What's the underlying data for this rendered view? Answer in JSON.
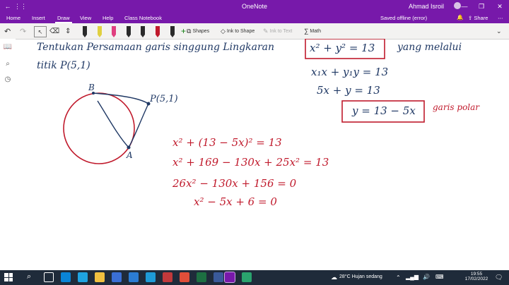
{
  "app": {
    "title": "OneNote",
    "user": "Ahmad Isroil"
  },
  "tabs": [
    "Home",
    "Insert",
    "Draw",
    "View",
    "Help",
    "Class Notebook"
  ],
  "active_tab": "Draw",
  "status": {
    "saved": "Saved offline (error)",
    "share": "Share"
  },
  "ribbon": {
    "shapes": "Shapes",
    "ink_to_shape": "Ink to Shape",
    "ink_to_text": "Ink to Text",
    "math": "Math"
  },
  "pens": [
    "#2b2b2b",
    "#e0d040",
    "#e04080",
    "#2b2b2b",
    "#2b2b2b",
    "#2b2b2b",
    "#c01a2c",
    "#2b2b2b"
  ],
  "notes": {
    "line1": "Tentukan Persamaan garis singgung Lingkaran",
    "boxed_eq": "x² + y² = 13",
    "line1_end": "yang melalui",
    "line2": "titik P(5,1)",
    "eq1": "x₁x + y₁y = 13",
    "eq2": "5x + y = 13",
    "eq3": "y = 13 − 5x",
    "eq3_label": "garis polar",
    "sub1": "x² + (13 − 5x)² = 13",
    "sub2": "x² + 169 − 130x + 25x² = 13",
    "sub3": "26x² − 130x + 156 = 0",
    "sub4": "x² − 5x + 6 = 0",
    "point_b": "B",
    "point_a": "A",
    "point_p": "P(5,1)"
  },
  "taskbar": {
    "weather": "28°C  Hujan sedang",
    "time": "19:55",
    "date": "17/02/2022"
  }
}
